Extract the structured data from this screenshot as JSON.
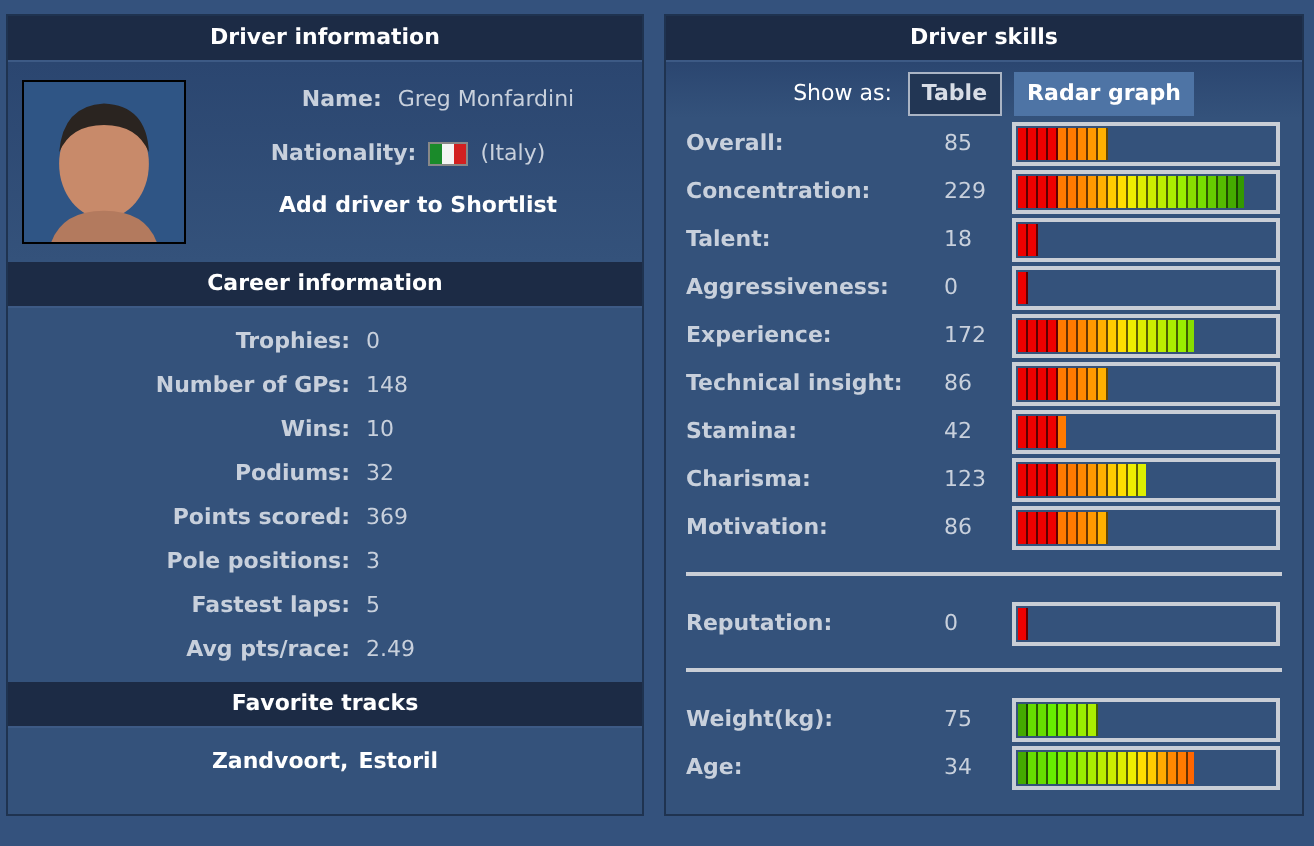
{
  "driver_information": {
    "title": "Driver information",
    "name_label": "Name:",
    "name": "Greg Monfardini",
    "nationality_label": "Nationality:",
    "nationality": "(Italy)",
    "action": "Add driver to Shortlist"
  },
  "career_information": {
    "title": "Career information",
    "rows": [
      {
        "label": "Trophies:",
        "value": "0"
      },
      {
        "label": "Number of GPs:",
        "value": "148"
      },
      {
        "label": "Wins:",
        "value": "10"
      },
      {
        "label": "Podiums:",
        "value": "32"
      },
      {
        "label": "Points scored:",
        "value": "369"
      },
      {
        "label": "Pole positions:",
        "value": "3"
      },
      {
        "label": "Fastest laps:",
        "value": "5"
      },
      {
        "label": "Avg pts/race:",
        "value": "2.49"
      }
    ]
  },
  "favorite_tracks": {
    "title": "Favorite tracks",
    "tracks": [
      "Zandvoort,",
      "Estoril"
    ]
  },
  "driver_skills": {
    "title": "Driver skills",
    "show_as_label": "Show as:",
    "view_tabs": [
      {
        "label": "Table",
        "selected": true
      },
      {
        "label": "Radar graph",
        "selected": false
      }
    ],
    "groups": [
      [
        {
          "label": "Overall:",
          "value": "85",
          "level": 0.35,
          "kind": "skill"
        },
        {
          "label": "Concentration:",
          "value": "229",
          "level": 0.88,
          "kind": "skill"
        },
        {
          "label": "Talent:",
          "value": "18",
          "level": 0.08,
          "kind": "skill"
        },
        {
          "label": "Aggressiveness:",
          "value": "0",
          "level": 0.04,
          "kind": "skill"
        },
        {
          "label": "Experience:",
          "value": "172",
          "level": 0.69,
          "kind": "skill"
        },
        {
          "label": "Technical insight:",
          "value": "86",
          "level": 0.35,
          "kind": "skill"
        },
        {
          "label": "Stamina:",
          "value": "42",
          "level": 0.19,
          "kind": "skill"
        },
        {
          "label": "Charisma:",
          "value": "123",
          "level": 0.5,
          "kind": "skill"
        },
        {
          "label": "Motivation:",
          "value": "86",
          "level": 0.35,
          "kind": "skill"
        }
      ],
      [
        {
          "label": "Reputation:",
          "value": "0",
          "level": 0.04,
          "kind": "skill"
        }
      ],
      [
        {
          "label": "Weight(kg):",
          "value": "75",
          "level": 0.31,
          "kind": "physical"
        },
        {
          "label": "Age:",
          "value": "34",
          "level": 0.69,
          "kind": "physical"
        }
      ]
    ]
  }
}
